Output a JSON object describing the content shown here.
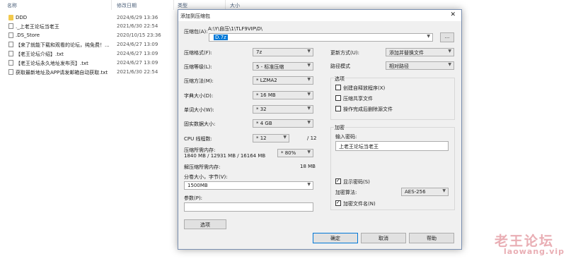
{
  "explorer": {
    "col_name": "名称",
    "col_date": "修改日期",
    "col_type": "类型",
    "col_size": "大小",
    "files": [
      {
        "name": "DDD",
        "date": "2024/6/29 13:36",
        "icon": "folder-icon"
      },
      {
        "name": "._上老王论坛当老王",
        "date": "2021/6/30 22:54",
        "icon": "file-icon"
      },
      {
        "name": ".DS_Store",
        "date": "2020/10/15 23:36",
        "icon": "file-icon"
      },
      {
        "name": "【来了就能下载和观看的论坛，纯免费！...",
        "date": "2024/6/27 13:09",
        "icon": "file-icon"
      },
      {
        "name": "【老王论坛介绍】.txt",
        "date": "2024/6/27 13:09",
        "icon": "file-icon"
      },
      {
        "name": "【老王论坛永久地址发布页】.txt",
        "date": "2024/6/27 13:09",
        "icon": "file-icon"
      },
      {
        "name": "获取最新地址及APP请发邮箱自动获取.txt",
        "date": "2021/6/30 22:54",
        "icon": "file-icon"
      }
    ]
  },
  "dialog": {
    "title": "添加到压缩包",
    "archive_label": "压缩包(A):",
    "archive_path": "A:\\Y\\自压\\1\\TLF9VIP\\D\\",
    "archive_file": "D.7z",
    "browse_label": "...",
    "format_label": "压缩格式(F):",
    "format_value": "7z",
    "level_label": "压缩等级(L):",
    "level_value": "5 - 标准压缩",
    "method_label": "压缩方法(M):",
    "method_value": "* LZMA2",
    "dict_label": "字典大小(D):",
    "dict_value": "* 16 MB",
    "word_label": "单词大小(W):",
    "word_value": "* 32",
    "solid_label": "固实数据大小:",
    "solid_value": "* 4 GB",
    "cpu_label": "CPU 线程数:",
    "cpu_value": "* 12",
    "cpu_total": "/ 12",
    "mem_label": "压缩所需内存:",
    "mem_detail": "1840 MB / 12931 MB / 16164 MB",
    "mem_percent": "* 80%",
    "decomp_label": "解压缩所需内存:",
    "decomp_value": "18 MB",
    "split_label": "分卷大小，字节(V):",
    "split_value": "1500MB",
    "params_label": "参数(P):",
    "params_value": "",
    "options_button": "选项",
    "update_label": "更新方式(U):",
    "update_value": "添加并替换文件",
    "pathmode_label": "路径模式",
    "pathmode_value": "相对路径",
    "opts_group": "选项",
    "opt_sfx": "创建自释放程序(X)",
    "opt_shared": "压缩共享文件",
    "opt_delete": "操作完成后删除源文件",
    "enc_group": "加密",
    "pwd_label": "输入密码:",
    "pwd_value": "上老王论坛当老王",
    "show_pwd": "显示密码(S)",
    "enc_method_label": "加密算法:",
    "enc_method_value": "AES-256",
    "enc_names": "加密文件名(N)",
    "ok": "确定",
    "cancel": "取消",
    "help": "帮助"
  },
  "watermark": {
    "cn": "老王论坛",
    "url": "laowang.vip"
  }
}
